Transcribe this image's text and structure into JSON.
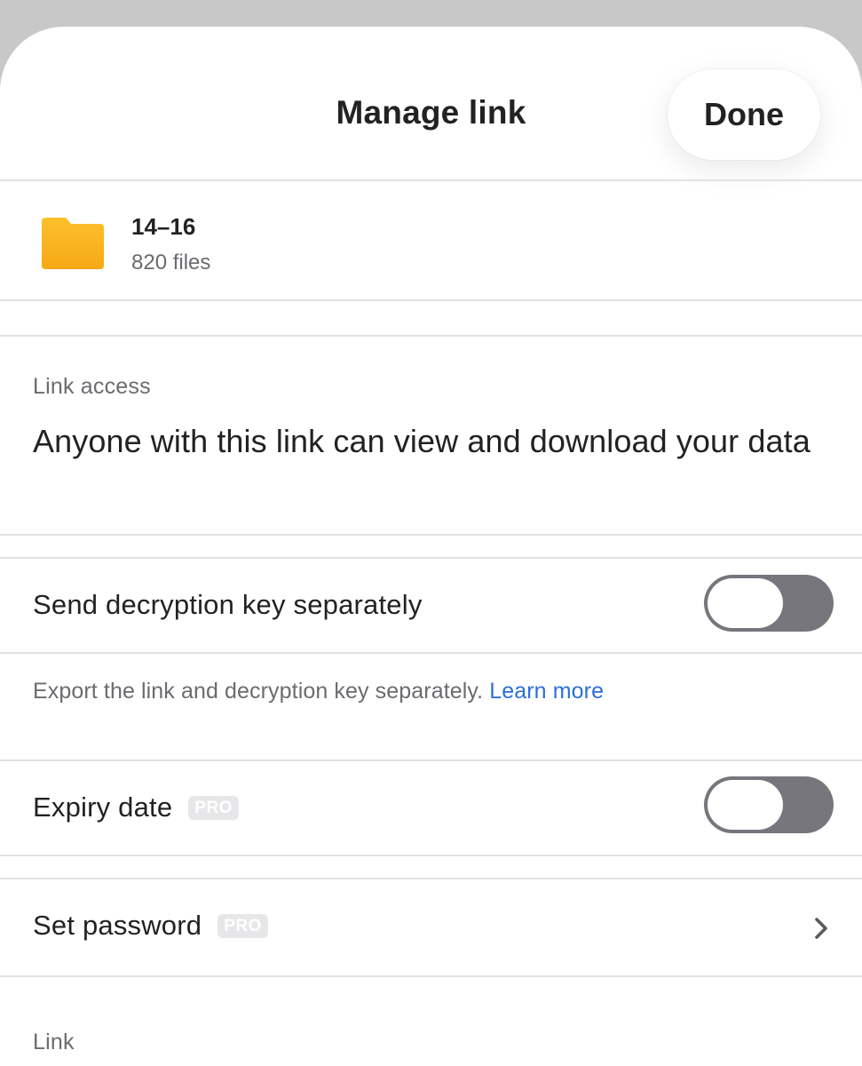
{
  "header": {
    "title": "Manage link",
    "done_label": "Done"
  },
  "file": {
    "name": "14–16",
    "count": "820 files",
    "icon": "folder-icon",
    "icon_color": "#f9b21c"
  },
  "link_access": {
    "label": "Link access",
    "description": "Anyone with this link can view and download your data"
  },
  "decryption": {
    "label": "Send decryption key separately",
    "toggle_on": false,
    "helper_text": "Export the link and decryption key separately.",
    "learn_more": "Learn more"
  },
  "expiry": {
    "label": "Expiry date",
    "badge": "PRO",
    "toggle_on": false
  },
  "password": {
    "label": "Set password",
    "badge": "PRO",
    "icon": "chevron-right-icon"
  },
  "link_section": {
    "label": "Link"
  },
  "colors": {
    "accent_link": "#2b6fd8",
    "toggle_off": "#77767d",
    "backdrop": "#c8c8c8"
  }
}
